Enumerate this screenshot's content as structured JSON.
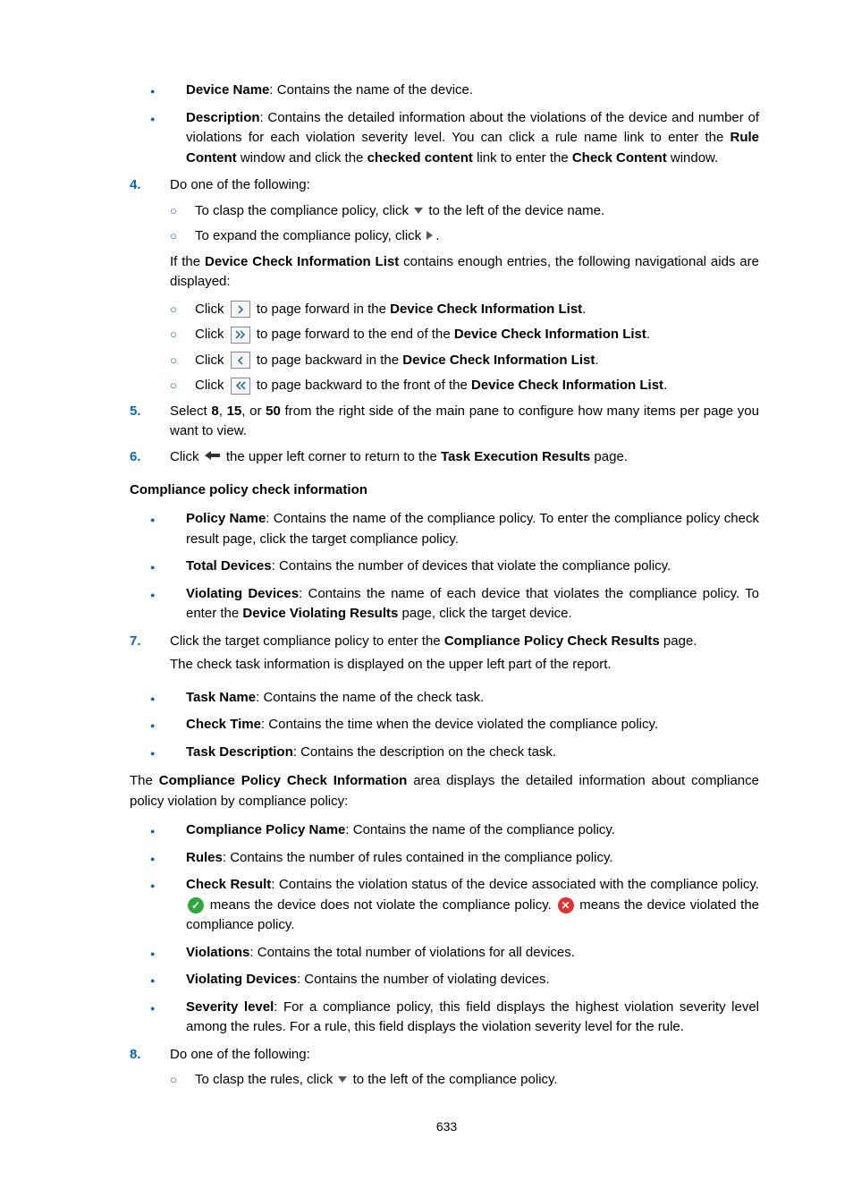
{
  "bullets_top": {
    "b1_label": "Device Name",
    "b1_text": ": Contains the name of the device.",
    "b2_label": "Description",
    "b2_text_a": ": Contains the detailed information about the violations of the device and number of violations for each violation severity level. You can click a rule name link to enter the ",
    "b2_bold_a": "Rule Content",
    "b2_text_b": " window and click the ",
    "b2_bold_b": "checked content",
    "b2_text_c": " link to enter the ",
    "b2_bold_c": "Check Content",
    "b2_text_d": " window."
  },
  "step4": {
    "num": "4.",
    "intro": "Do one of the following:",
    "c1_a": "To clasp the compliance policy, click ",
    "c1_b": " to the left of the device name.",
    "c2_a": "To expand the compliance policy, click ",
    "c2_b": ".",
    "para_a": "If the ",
    "para_bold": "Device Check Information List",
    "para_b": " contains enough entries, the following navigational aids are displayed:",
    "n1_a": "Click ",
    "n1_b": " to page forward in the ",
    "n1_bold": "Device Check Information List",
    "n1_c": ".",
    "n2_a": "Click ",
    "n2_b": " to page forward to the end of the ",
    "n2_bold": "Device Check Information List",
    "n2_c": ".",
    "n3_a": "Click ",
    "n3_b": " to page backward in the ",
    "n3_bold": "Device Check Information List",
    "n3_c": ".",
    "n4_a": "Click ",
    "n4_b": " to page backward to the front of the ",
    "n4_bold": "Device Check Information List",
    "n4_c": "."
  },
  "step5": {
    "num": "5.",
    "a": "Select ",
    "v1": "8",
    "sep1": ", ",
    "v2": "15",
    "sep2": ", or ",
    "v3": "50",
    "b": " from the right side of the main pane to configure how many items per page you want to view."
  },
  "step6": {
    "num": "6.",
    "a": "Click ",
    "b": " the upper left corner to return to the ",
    "bold": "Task Execution Results",
    "c": " page."
  },
  "heading1": "Compliance policy check information",
  "pol": {
    "p1_label": "Policy Name",
    "p1_text": ": Contains the name of the compliance policy. To enter the compliance policy check result page, click the target compliance policy.",
    "p2_label": "Total Devices",
    "p2_text": ": Contains the number of devices that violate the compliance policy.",
    "p3_label": "Violating Devices",
    "p3_text_a": ": Contains the name of each device that violates the compliance policy. To enter the ",
    "p3_bold": "Device Violating Results",
    "p3_text_b": " page, click the target device."
  },
  "step7": {
    "num": "7.",
    "a": "Click the target compliance policy to enter the ",
    "bold": "Compliance Policy Check Results",
    "b": " page.",
    "sub": "The check task information is displayed on the upper left part of the report."
  },
  "task": {
    "t1_label": "Task Name",
    "t1_text": ": Contains the name of the check task.",
    "t2_label": "Check Time",
    "t2_text": ": Contains the time when the device violated the compliance policy.",
    "t3_label": "Task Description",
    "t3_text": ": Contains the description on the check task."
  },
  "para_mid_a": "The ",
  "para_mid_bold": "Compliance Policy Check Information",
  "para_mid_b": " area displays the detailed information about compliance policy violation by compliance policy:",
  "comp": {
    "c1_label": "Compliance Policy Name",
    "c1_text": ": Contains the name of the compliance policy.",
    "c2_label": "Rules",
    "c2_text": ": Contains the number of rules contained in the compliance policy.",
    "c3_label": "Check Result",
    "c3_text_a": ": Contains the violation status of the device associated with the compliance policy. ",
    "c3_text_b": " means the device does not violate the compliance policy. ",
    "c3_text_c": " means the device violated the compliance policy.",
    "c4_label": "Violations",
    "c4_text": ": Contains the total number of violations for all devices.",
    "c5_label": "Violating Devices",
    "c5_text": ": Contains the number of violating devices.",
    "c6_label": "Severity level",
    "c6_text": ": For a compliance policy, this field displays the highest violation severity level among the rules. For a rule, this field displays the violation severity level for the rule."
  },
  "step8": {
    "num": "8.",
    "intro": "Do one of the following:",
    "c1_a": "To clasp the rules, click ",
    "c1_b": " to the left of the compliance policy."
  },
  "page_number": "633"
}
